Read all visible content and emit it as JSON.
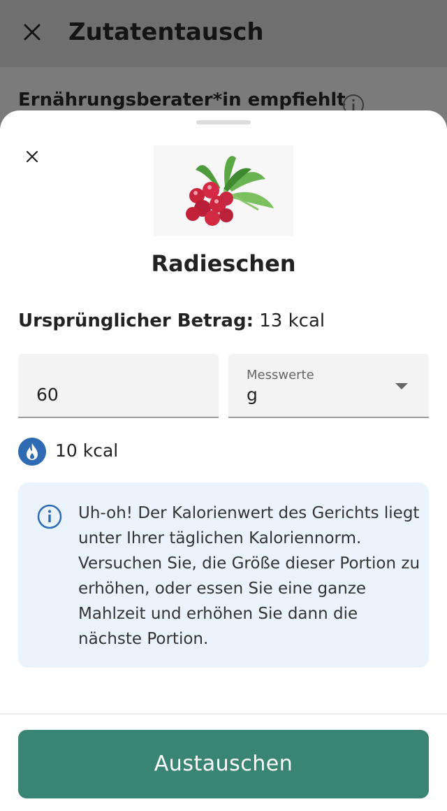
{
  "background_page": {
    "title": "Zutatentausch",
    "section_title": "Ernährungsberater*in empfiehlt"
  },
  "sheet": {
    "food_name": "Radieschen",
    "original_label": "Ursprünglicher Betrag:",
    "original_value": "13 kcal",
    "amount_value": "60",
    "unit_label": "Messwerte",
    "unit_value": "g",
    "calories": "10 kcal",
    "notice": "Uh-oh! Der Kalorienwert des Gerichts liegt unter Ihrer täglichen Kaloriennorm. Versuchen Sie, die Größe dieser Portion zu erhöhen, oder essen Sie eine ganze Mahlzeit und erhöhen Sie dann die nächste Portion.",
    "button_label": "Austauschen"
  },
  "icons": {
    "close": "close-icon",
    "info": "info-icon",
    "flame": "flame-icon",
    "dropdown": "chevron-down-icon"
  },
  "colors": {
    "primary_button": "#3a8473",
    "flame_badge": "#2f6bb3",
    "info_blue": "#2f6bb3",
    "notice_bg": "#eaf3fc"
  }
}
